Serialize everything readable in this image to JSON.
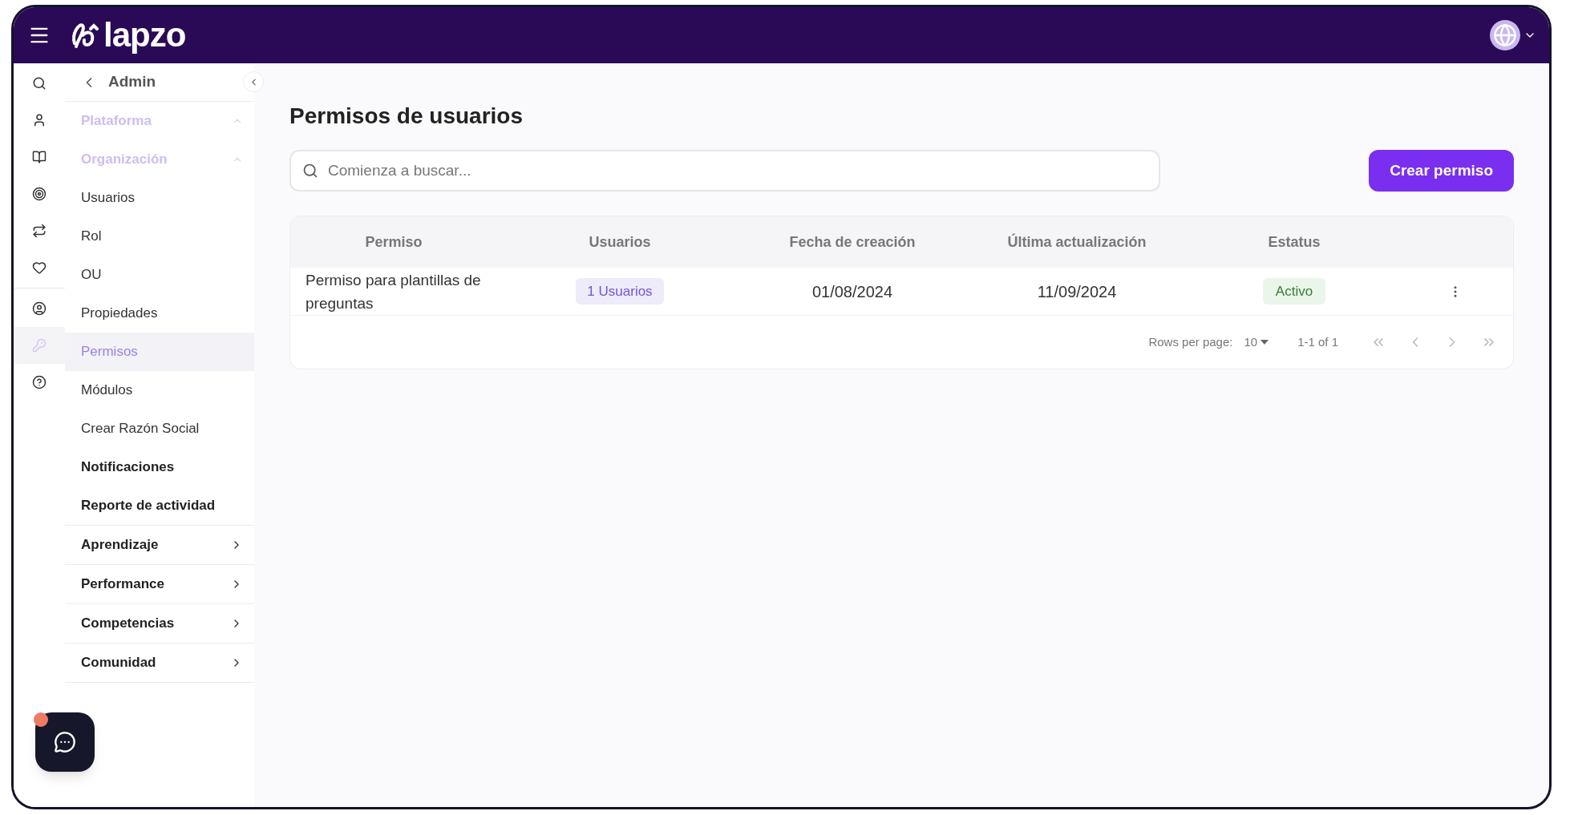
{
  "header": {
    "logo": "lapzo"
  },
  "rail": [
    {
      "kind": "search",
      "selected": false
    },
    {
      "kind": "user",
      "selected": false
    },
    {
      "kind": "book",
      "selected": false
    },
    {
      "kind": "target",
      "selected": false
    },
    {
      "kind": "swap",
      "selected": false
    },
    {
      "kind": "heart",
      "selected": false
    },
    {
      "kind": "badge",
      "selected": false
    },
    {
      "kind": "key",
      "selected": true
    },
    {
      "kind": "help",
      "selected": false
    }
  ],
  "sidebar": {
    "back_label": "Admin",
    "items": [
      {
        "kind": "section",
        "label": "Plataforma",
        "expanded": true
      },
      {
        "kind": "section",
        "label": "Organización",
        "expanded": true
      },
      {
        "kind": "link",
        "label": "Usuarios",
        "selected": false
      },
      {
        "kind": "link",
        "label": "Rol",
        "selected": false
      },
      {
        "kind": "link",
        "label": "OU",
        "selected": false
      },
      {
        "kind": "link",
        "label": "Propiedades",
        "selected": false
      },
      {
        "kind": "link",
        "label": "Permisos",
        "selected": true
      },
      {
        "kind": "link",
        "label": "Módulos",
        "selected": false
      },
      {
        "kind": "link",
        "label": "Crear Razón Social",
        "selected": false
      },
      {
        "kind": "bold",
        "label": "Notificaciones"
      },
      {
        "kind": "bold",
        "label": "Reporte de actividad"
      },
      {
        "kind": "group",
        "label": "Aprendizaje"
      },
      {
        "kind": "group",
        "label": "Performance"
      },
      {
        "kind": "group",
        "label": "Competencias"
      },
      {
        "kind": "group",
        "label": "Comunidad"
      }
    ]
  },
  "chat": {
    "unread": true
  },
  "page": {
    "title": "Permisos de usuarios",
    "search": {
      "placeholder": "Comienza a buscar..."
    },
    "create_button": "Crear permiso"
  },
  "table": {
    "columns": [
      "Permiso",
      "Usuarios",
      "Fecha de creación",
      "Última actualización",
      "Estatus"
    ],
    "rows": [
      {
        "permiso": "Permiso para plantillas de preguntas",
        "usuarios": "1 Usuarios",
        "created": "01/08/2024",
        "updated": "11/09/2024",
        "status": {
          "kind": "active",
          "label": "Activo"
        }
      }
    ],
    "pagination": {
      "rows_label": "Rows per page:",
      "rows_value": "10",
      "range": "1-1 of 1"
    }
  }
}
